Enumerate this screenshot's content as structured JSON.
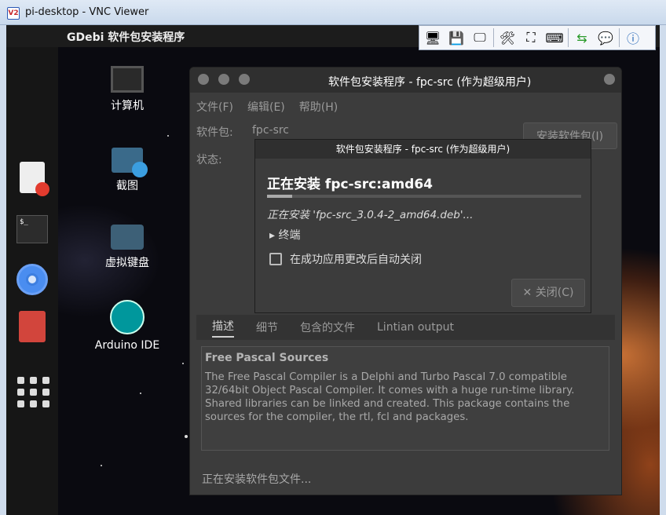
{
  "vnc_window": {
    "title": "pi-desktop - VNC Viewer",
    "icon_label": "V2"
  },
  "top_panel": {
    "app_title": "GDebi 软件包安装程序"
  },
  "desktop_icons": [
    {
      "label": "计算机",
      "icon": "computer-icon"
    },
    {
      "label": "截图",
      "icon": "screenshot-icon"
    },
    {
      "label": "虚拟键盘",
      "icon": "keyboard-icon"
    },
    {
      "label": "Arduino IDE",
      "icon": "arduino-icon"
    }
  ],
  "terminal_prompt": "$_",
  "gdebi": {
    "title": "软件包安装程序 - fpc-src (作为超级用户)",
    "menu": [
      "文件(F)",
      "编辑(E)",
      "帮助(H)"
    ],
    "package_label": "软件包:",
    "package_value": "fpc-src",
    "status_label": "状态:",
    "install_button": "安装软件包(I)",
    "tabs": [
      "描述",
      "细节",
      "包含的文件",
      "Lintian output"
    ],
    "description_title": "Free Pascal Sources",
    "description_text": "The Free Pascal Compiler is a Delphi and Turbo Pascal 7.0 compatible 32/64bit Object Pascal Compiler. It comes with a huge run-time library. Shared libraries can be linked and created. This package contains the sources for the compiler, the rtl, fcl and packages.",
    "bottom_status": "正在安装软件包文件..."
  },
  "dialog": {
    "title": "软件包安装程序 - fpc-src (作为超级用户)",
    "heading": "正在安装 fpc-src:amd64",
    "progress": 0.08,
    "file_line": "正在安装 'fpc-src_3.0.4-2_amd64.deb'...",
    "terminal_toggle": "终端",
    "auto_close_label": "在成功应用更改后自动关闭",
    "close_button": "关闭(C)"
  }
}
